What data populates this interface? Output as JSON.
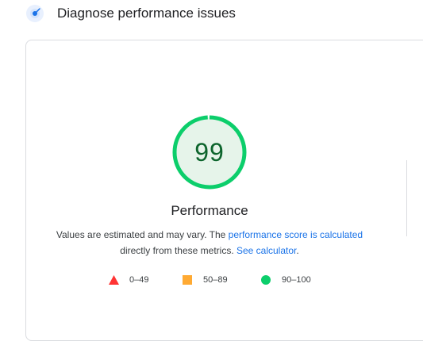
{
  "header": {
    "title": "Diagnose performance issues",
    "icon": "speed-gauge-icon"
  },
  "score": {
    "value": "99",
    "fraction": 0.99,
    "label": "Performance",
    "color_ring": "#0cce6b",
    "color_fill": "#e6f4ea",
    "color_text": "#0d652d"
  },
  "description": {
    "part1": "Values are estimated and may vary. The ",
    "link1": "performance score is calculated",
    "part2": "directly from these metrics. ",
    "link2": "See calculator",
    "part3": ".",
    "link_color": "#1a73e8"
  },
  "legend": [
    {
      "shape": "triangle",
      "range": "0–49",
      "color": "#ff3333"
    },
    {
      "shape": "square",
      "range": "50–89",
      "color": "#ffaa33"
    },
    {
      "shape": "circle",
      "range": "90–100",
      "color": "#0cce6b"
    }
  ]
}
